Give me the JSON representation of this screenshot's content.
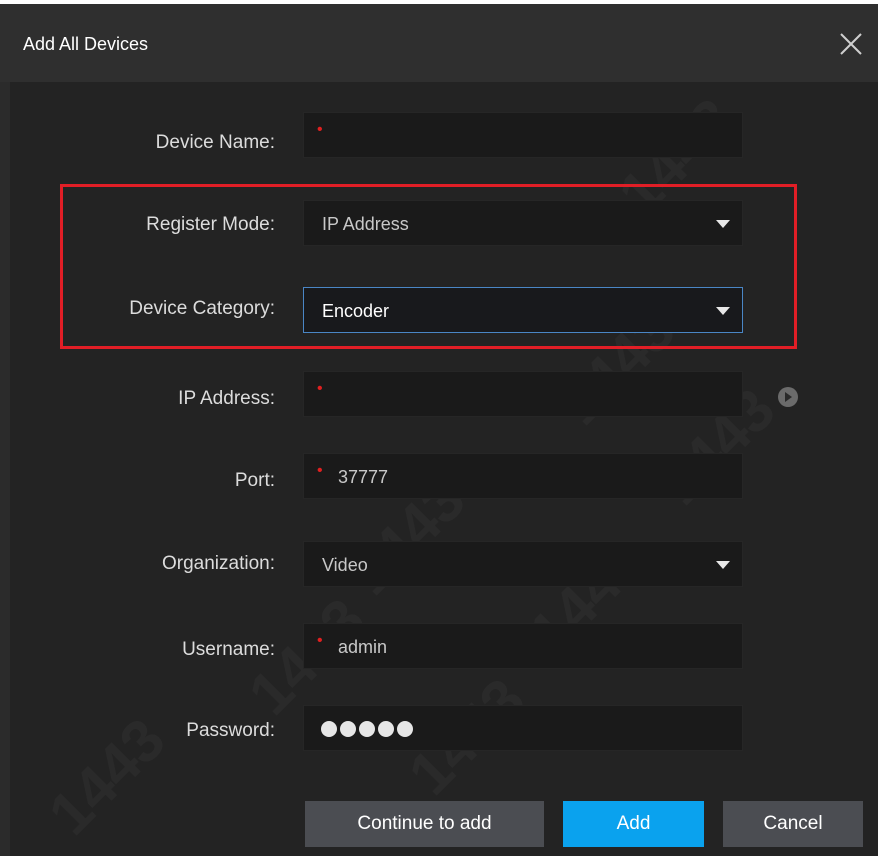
{
  "dialog": {
    "title": "Add All Devices"
  },
  "form": {
    "device_name": {
      "label": "Device Name:",
      "value": "",
      "required": true
    },
    "register_mode": {
      "label": "Register Mode:",
      "value": "IP Address"
    },
    "device_category": {
      "label": "Device Category:",
      "value": "Encoder"
    },
    "ip_address": {
      "label": "IP Address:",
      "value": "",
      "required": true
    },
    "port": {
      "label": "Port:",
      "value": "37777",
      "required": true
    },
    "organization": {
      "label": "Organization:",
      "value": "Video"
    },
    "username": {
      "label": "Username:",
      "value": "admin",
      "required": true
    },
    "password": {
      "label": "Password:",
      "masked_length": 5
    }
  },
  "buttons": {
    "continue": "Continue to add",
    "add": "Add",
    "cancel": "Cancel"
  },
  "icons": {
    "close": "close-icon",
    "caret": "chevron-down-icon",
    "play": "play-icon"
  },
  "colors": {
    "accent": "#0aa2ee",
    "highlight": "#e11e26",
    "required": "#e02020"
  },
  "watermark": "1443"
}
